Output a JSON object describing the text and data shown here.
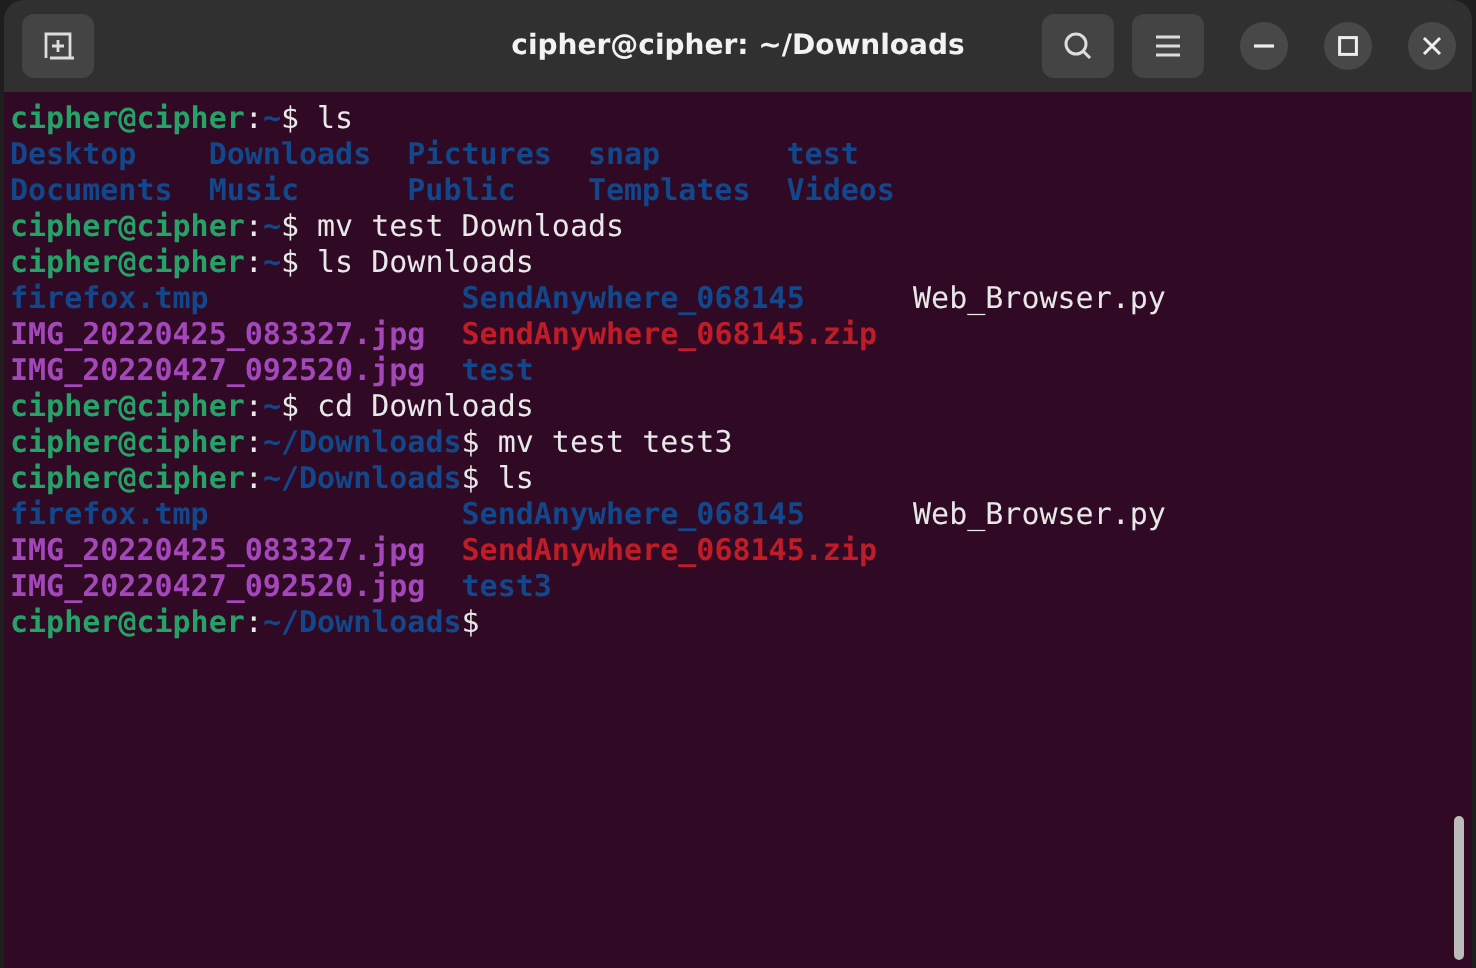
{
  "window": {
    "title": "cipher@cipher: ~/Downloads"
  },
  "terminal": {
    "lines": [
      {
        "kind": "prompt",
        "user": "cipher@cipher",
        "separator": ":",
        "path": "~",
        "symbol": "$",
        "command": " ls"
      },
      {
        "kind": "listing",
        "rows": [
          [
            {
              "name": "Desktop",
              "kind": "dir"
            },
            {
              "name": "Downloads",
              "kind": "dir"
            },
            {
              "name": "Pictures",
              "kind": "dir"
            },
            {
              "name": "snap",
              "kind": "dir"
            },
            {
              "name": "test",
              "kind": "dir"
            }
          ],
          [
            {
              "name": "Documents",
              "kind": "dir"
            },
            {
              "name": "Music",
              "kind": "dir"
            },
            {
              "name": "Public",
              "kind": "dir"
            },
            {
              "name": "Templates",
              "kind": "dir"
            },
            {
              "name": "Videos",
              "kind": "dir"
            }
          ]
        ]
      },
      {
        "kind": "prompt",
        "user": "cipher@cipher",
        "separator": ":",
        "path": "~",
        "symbol": "$",
        "command": " mv test Downloads"
      },
      {
        "kind": "prompt",
        "user": "cipher@cipher",
        "separator": ":",
        "path": "~",
        "symbol": "$",
        "command": " ls Downloads"
      },
      {
        "kind": "listing",
        "rows": [
          [
            {
              "name": "firefox.tmp",
              "kind": "dir"
            },
            {
              "name": "SendAnywhere_068145",
              "kind": "dir"
            },
            {
              "name": "Web_Browser.py",
              "kind": "file"
            }
          ],
          [
            {
              "name": "IMG_20220425_083327.jpg",
              "kind": "image"
            },
            {
              "name": "SendAnywhere_068145.zip",
              "kind": "archive"
            }
          ],
          [
            {
              "name": "IMG_20220427_092520.jpg",
              "kind": "image"
            },
            {
              "name": "test",
              "kind": "dir"
            }
          ]
        ]
      },
      {
        "kind": "prompt",
        "user": "cipher@cipher",
        "separator": ":",
        "path": "~",
        "symbol": "$",
        "command": " cd Downloads"
      },
      {
        "kind": "prompt",
        "user": "cipher@cipher",
        "separator": ":",
        "path": "~/Downloads",
        "symbol": "$",
        "command": " mv test test3"
      },
      {
        "kind": "prompt",
        "user": "cipher@cipher",
        "separator": ":",
        "path": "~/Downloads",
        "symbol": "$",
        "command": " ls"
      },
      {
        "kind": "listing",
        "rows": [
          [
            {
              "name": "firefox.tmp",
              "kind": "dir"
            },
            {
              "name": "SendAnywhere_068145",
              "kind": "dir"
            },
            {
              "name": "Web_Browser.py",
              "kind": "file"
            }
          ],
          [
            {
              "name": "IMG_20220425_083327.jpg",
              "kind": "image"
            },
            {
              "name": "SendAnywhere_068145.zip",
              "kind": "archive"
            }
          ],
          [
            {
              "name": "IMG_20220427_092520.jpg",
              "kind": "image"
            },
            {
              "name": "test3",
              "kind": "dir"
            }
          ]
        ]
      },
      {
        "kind": "prompt",
        "user": "cipher@cipher",
        "separator": ":",
        "path": "~/Downloads",
        "symbol": "$"
      }
    ]
  }
}
